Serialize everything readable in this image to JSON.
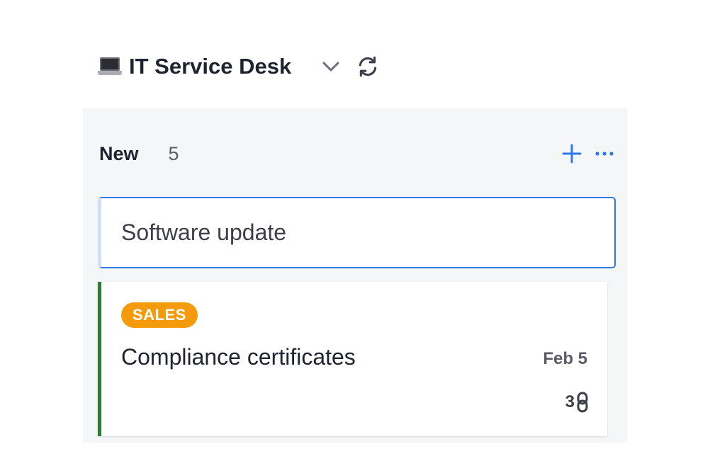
{
  "header": {
    "board_title": "IT Service Desk",
    "board_icon": "laptop-icon",
    "dropdown_icon": "chevron-down-icon",
    "refresh_icon": "refresh-icon"
  },
  "column": {
    "name": "New",
    "count": "5",
    "add_icon": "plus-icon",
    "more_icon": "more-horizontal-icon",
    "new_card_input_value": "Software update"
  },
  "cards": [
    {
      "tag": "SALES",
      "tag_color": "#f59a0b",
      "accent_color": "#2e7d32",
      "title": "Compliance certificates",
      "date": "Feb 5",
      "links_count": "3",
      "links_icon": "link-icon"
    }
  ],
  "colors": {
    "accent": "#2f7ae5",
    "column_bg": "#f5f6f8",
    "text": "#1f2330"
  }
}
